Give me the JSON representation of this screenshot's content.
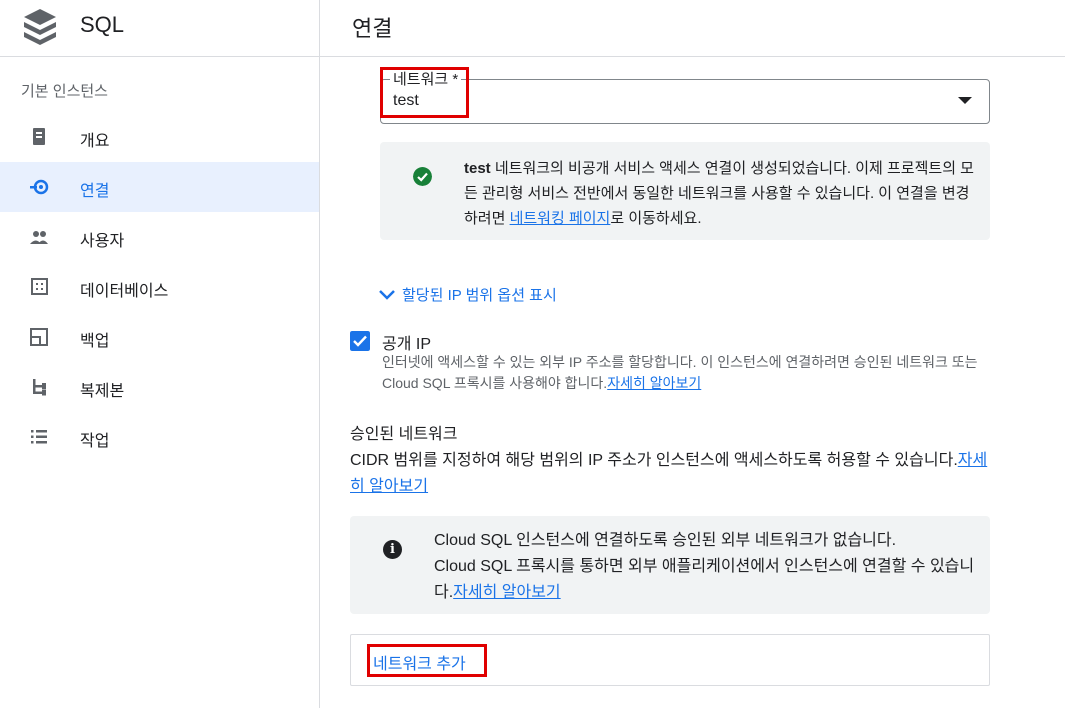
{
  "sidebar": {
    "product_title": "SQL",
    "section_label": "기본 인스턴스",
    "items": [
      {
        "label": "개요",
        "icon": "overview-icon"
      },
      {
        "label": "연결",
        "icon": "connections-icon",
        "active": true
      },
      {
        "label": "사용자",
        "icon": "users-icon"
      },
      {
        "label": "데이터베이스",
        "icon": "databases-icon"
      },
      {
        "label": "백업",
        "icon": "backups-icon"
      },
      {
        "label": "복제본",
        "icon": "replicas-icon"
      },
      {
        "label": "작업",
        "icon": "operations-icon"
      }
    ]
  },
  "header": {
    "title": "연결"
  },
  "network_field": {
    "legend": "네트워크 *",
    "value": "test"
  },
  "success_banner": {
    "bold": "test",
    "text": " 네트워크의 비공개 서비스 액세스 연결이 생성되었습니다. 이제 프로젝트의 모든 관리형 서비스 전반에서 동일한 네트워크를 사용할 수 있습니다. 이 연결을 변경하려면 ",
    "link": "네트워킹 페이지",
    "suffix": "로 이동하세요."
  },
  "ip_range_toggle": "할당된 IP 범위 옵션 표시",
  "public_ip": {
    "label": "공개 IP",
    "checked": true,
    "desc": "인터넷에 액세스할 수 있는 외부 IP 주소를 할당합니다. 이 인스턴스에 연결하려면 승인된 네트워크 또는 Cloud SQL 프록시를 사용해야 합니다.",
    "link": "자세히 알아보기"
  },
  "authorized": {
    "title": "승인된 네트워크",
    "desc": "CIDR 범위를 지정하여 해당 범위의 IP 주소가 인스턴스에 액세스하도록 허용할 수 있습니다.",
    "link": "자세히 알아보기"
  },
  "info_banner": {
    "line1": "Cloud SQL 인스턴스에 연결하도록 승인된 외부 네트워크가 없습니다.",
    "line2": "Cloud SQL 프록시를 통하면 외부 애플리케이션에서 인스턴스에 연결할 수 있습니다.",
    "link": "자세히 알아보기"
  },
  "add_network_label": "네트워크 추가",
  "colors": {
    "accent": "#1a73e8",
    "success": "#188038",
    "highlight": "#e00000"
  }
}
